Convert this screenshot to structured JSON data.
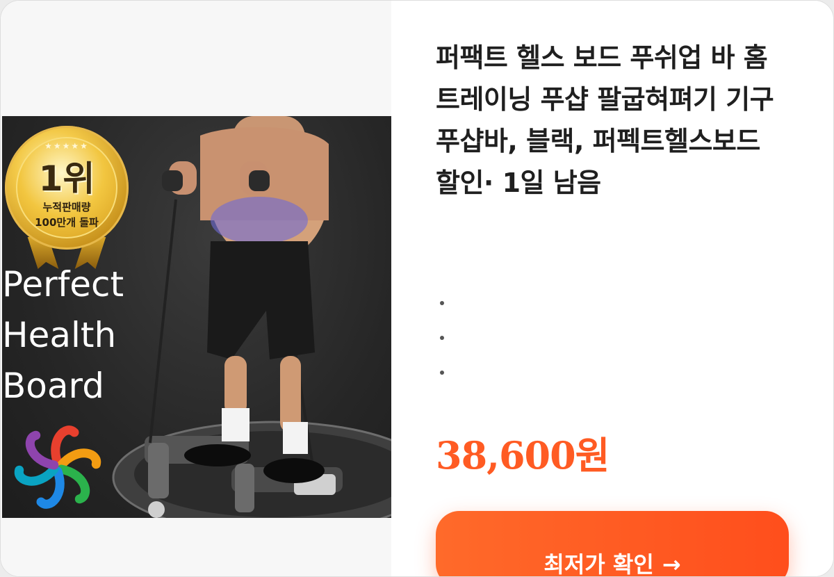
{
  "product": {
    "title": "퍼팩트 헬스 보드 푸쉬업 바 홈트레이닝 푸샵 팔굽혀펴기 기구 푸샵바, 블랙, 퍼펙트헬스보드할인· 1일 남음",
    "features": [
      "",
      "",
      ""
    ],
    "price": "38,600원",
    "cta_label": "최저가 확인",
    "cta_arrow": "→"
  },
  "image": {
    "badge": {
      "stars": "★★★★★",
      "rank": "1위",
      "line1": "누적판매량",
      "line2": "100만개 돌파"
    },
    "brand_lines": [
      "Perfect",
      "Health",
      "Board"
    ],
    "icons": {
      "logo": "flower-logo-icon"
    },
    "colors": {
      "logo_petals": [
        "#e8402e",
        "#f39c12",
        "#2bb24c",
        "#1e88e5",
        "#8e44ad",
        "#0aa3c2"
      ]
    }
  },
  "colors": {
    "price": "#ff5b23",
    "cta_start": "#ff6a2a",
    "cta_end": "#ff4e1c",
    "title": "#1f1f1f"
  }
}
